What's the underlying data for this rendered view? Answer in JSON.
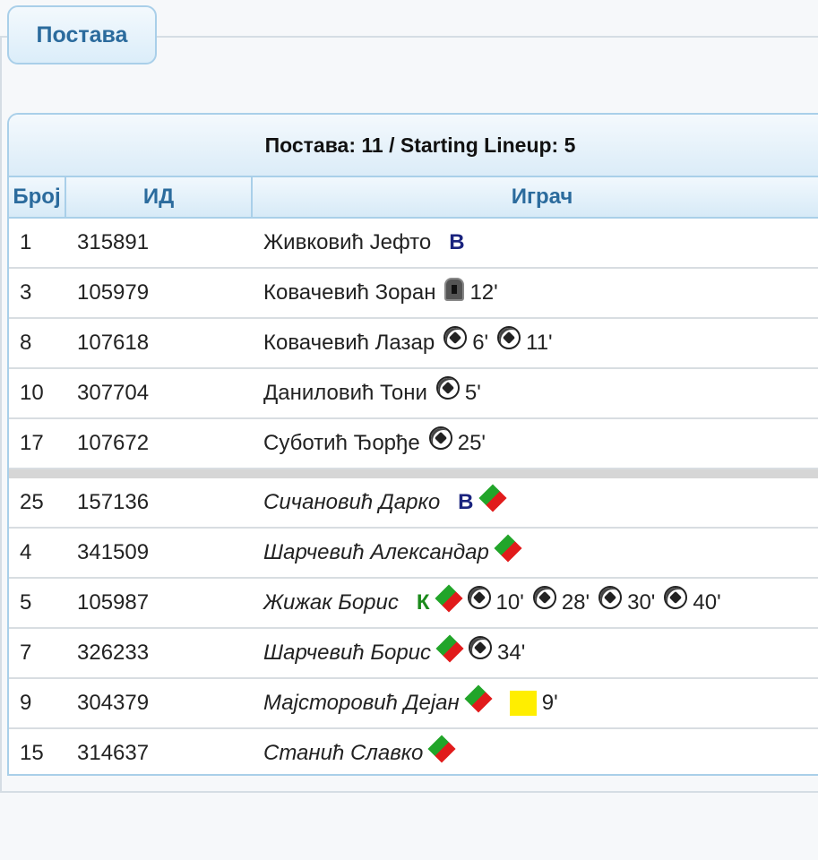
{
  "tab": {
    "label": "Постава"
  },
  "table": {
    "caption": "Постава: 11 / Starting Lineup: 5",
    "headers": {
      "number": "Број",
      "id": "ИД",
      "player": "Играч"
    },
    "starters": [
      {
        "number": "1",
        "id": "315891",
        "name": "Живковић Јефто",
        "badge": "В",
        "events": []
      },
      {
        "number": "3",
        "id": "105979",
        "name": "Ковачевић Зоран",
        "events": [
          {
            "icon": "goalkeeper-glove-icon",
            "minute": "12'"
          }
        ]
      },
      {
        "number": "8",
        "id": "107618",
        "name": "Ковачевић Лазар",
        "events": [
          {
            "icon": "ball-icon",
            "minute": "6'"
          },
          {
            "icon": "ball-icon",
            "minute": "11'"
          }
        ]
      },
      {
        "number": "10",
        "id": "307704",
        "name": "Даниловић Тони",
        "events": [
          {
            "icon": "ball-icon",
            "minute": "5'"
          }
        ]
      },
      {
        "number": "17",
        "id": "107672",
        "name": "Суботић Ђорђе",
        "events": [
          {
            "icon": "ball-icon",
            "minute": "25'"
          }
        ]
      }
    ],
    "substitutes": [
      {
        "number": "25",
        "id": "157136",
        "name": "Сичановић Дарко",
        "badge": "В",
        "sub_icon": "substitution-icon",
        "events": []
      },
      {
        "number": "4",
        "id": "341509",
        "name": "Шарчевић Александар",
        "sub_icon": "substitution-icon",
        "events": []
      },
      {
        "number": "5",
        "id": "105987",
        "name": "Жижак Борис",
        "badge": "К",
        "sub_icon": "substitution-icon",
        "events": [
          {
            "icon": "ball-icon",
            "minute": "10'"
          },
          {
            "icon": "ball-icon",
            "minute": "28'"
          },
          {
            "icon": "ball-icon",
            "minute": "30'"
          },
          {
            "icon": "ball-icon",
            "minute": "40'"
          }
        ]
      },
      {
        "number": "7",
        "id": "326233",
        "name": "Шарчевић Борис",
        "sub_icon": "substitution-icon",
        "events": [
          {
            "icon": "ball-icon",
            "minute": "34'"
          }
        ]
      },
      {
        "number": "9",
        "id": "304379",
        "name": "Мајсторовић Дејан",
        "sub_icon": "substitution-icon",
        "events": [
          {
            "icon": "yellow-card-icon",
            "minute": "9'"
          }
        ]
      },
      {
        "number": "15",
        "id": "314637",
        "name": "Станић Славко",
        "sub_icon": "substitution-icon",
        "events": []
      }
    ]
  },
  "colors": {
    "accent": "#2b6b9d",
    "border": "#a9cfe9",
    "captain": "#1b8a1b",
    "vice": "#1a237e",
    "yellow_card": "#ffee00"
  }
}
